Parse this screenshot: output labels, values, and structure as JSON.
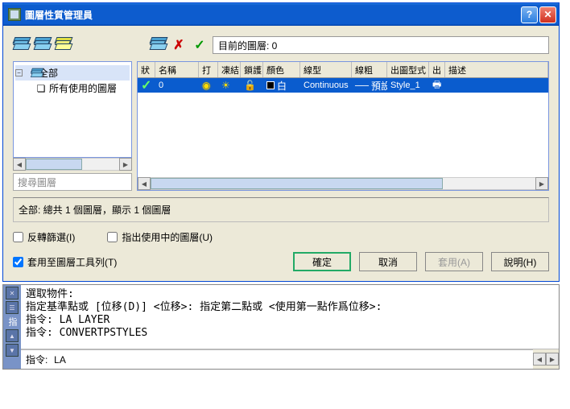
{
  "window": {
    "title": "圖層性質管理員",
    "current_layer_label": "目前的圖層: 0"
  },
  "tree": {
    "root_label": "全部",
    "child_label": "所有使用的圖層",
    "search_placeholder": "搜尋圖層"
  },
  "grid": {
    "headers": {
      "status": "狀",
      "name": "名稱",
      "on": "打",
      "freeze": "凍結",
      "lock": "鎖護",
      "color": "顏色",
      "linetype": "線型",
      "lineweight": "線粗",
      "plotstyle": "出圖型式",
      "plot": "出",
      "desc": "描述"
    },
    "row": {
      "name": "0",
      "color_name": "白",
      "linetype": "Continuous",
      "lineweight": "預設",
      "plotstyle": "Style_1"
    }
  },
  "summary": "全部: 總共 1 個圖層，顯示 1 個圖層",
  "checks": {
    "invert": "反轉篩選(I)",
    "inuse": "指出使用中的圖層(U)",
    "toolbar": "套用至圖層工具列(T)"
  },
  "buttons": {
    "ok": "確定",
    "cancel": "取消",
    "apply": "套用(A)",
    "help": "說明(H)"
  },
  "console": {
    "history": "選取物件:\n指定基準點或 [位移(D)] <位移>: 指定第二點或 <使用第一點作爲位移>:\n指令: LA LAYER\n指令: CONVERTPSTYLES",
    "prompt_label": "指令:",
    "prompt_value": "LA",
    "palette_label": "指"
  }
}
